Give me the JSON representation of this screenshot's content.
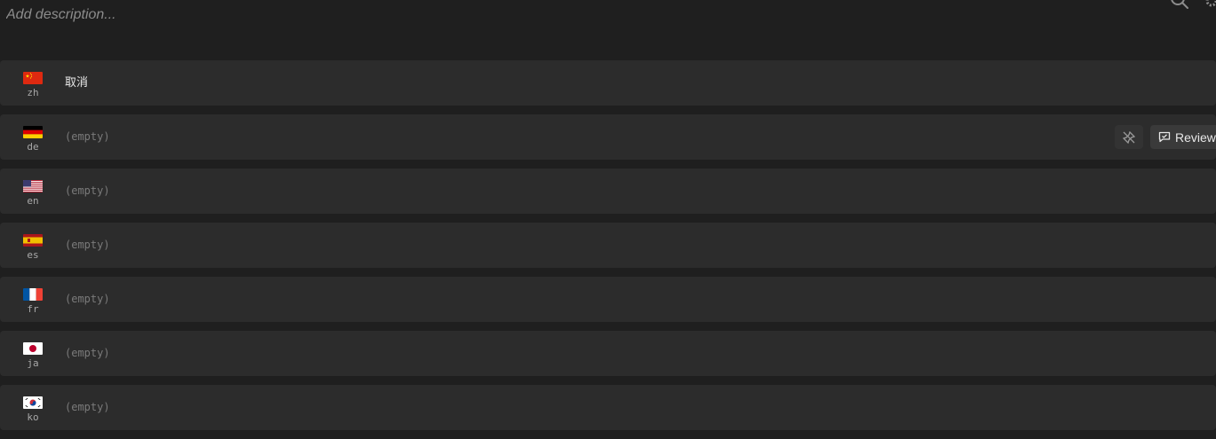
{
  "header": {
    "description_placeholder": "Add description..."
  },
  "translations": [
    {
      "lang": "zh",
      "flag": "china-flag-icon",
      "value": "取消",
      "empty": false
    },
    {
      "lang": "de",
      "flag": "germany-flag-icon",
      "value": "(empty)",
      "empty": true
    },
    {
      "lang": "en",
      "flag": "usa-flag-icon",
      "value": "(empty)",
      "empty": true
    },
    {
      "lang": "es",
      "flag": "spain-flag-icon",
      "value": "(empty)",
      "empty": true
    },
    {
      "lang": "fr",
      "flag": "france-flag-icon",
      "value": "(empty)",
      "empty": true
    },
    {
      "lang": "ja",
      "flag": "japan-flag-icon",
      "value": "(empty)",
      "empty": true
    },
    {
      "lang": "ko",
      "flag": "korea-flag-icon",
      "value": "(empty)",
      "empty": true
    }
  ],
  "row_actions": {
    "review_label": "Review",
    "pin_icon": "unpin-icon",
    "review_icon": "review-comment-icon"
  },
  "colors": {
    "background": "#1f1f1f",
    "row_background": "#2c2c2c",
    "text": "#e8e8e8",
    "muted_text": "#7a7a7a"
  }
}
